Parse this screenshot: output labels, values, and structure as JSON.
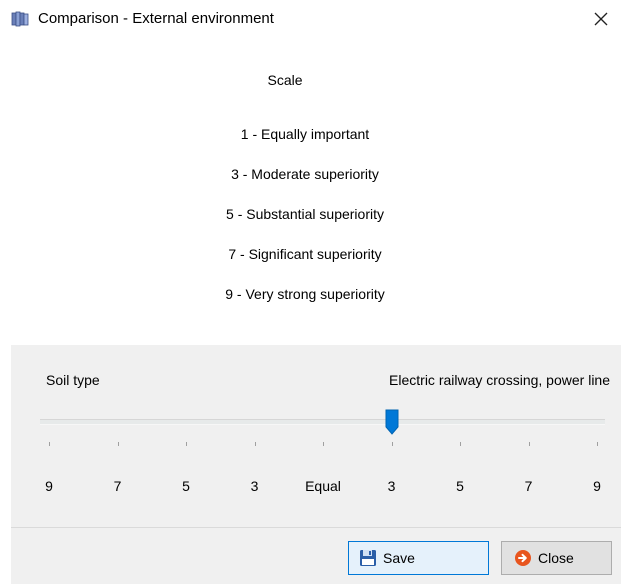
{
  "window": {
    "title": "Comparison - External environment",
    "icons": {
      "app": "database-stack-icon",
      "close": "close-icon"
    }
  },
  "scale": {
    "title": "Scale",
    "items": [
      "1 - Equally important",
      "3 - Moderate superiority",
      "5 - Substantial superiority",
      "7 - Significant superiority",
      "9 - Very strong superiority"
    ]
  },
  "comparison": {
    "left_label": "Soil type",
    "right_label": "Electric railway crossing, power line",
    "slider": {
      "ticks": [
        "9",
        "7",
        "5",
        "3",
        "Equal",
        "3",
        "5",
        "7",
        "9"
      ],
      "selected_index": 5,
      "selected_label": "3",
      "favors": "right"
    }
  },
  "buttons": {
    "save_label": "Save",
    "close_label": "Close",
    "save_icon": "floppy-disk-icon",
    "close_icon": "arrow-circle-icon"
  },
  "colors": {
    "accent": "#0078d7",
    "panel_bg": "#f0f0f0",
    "close_icon": "#e8551e"
  }
}
